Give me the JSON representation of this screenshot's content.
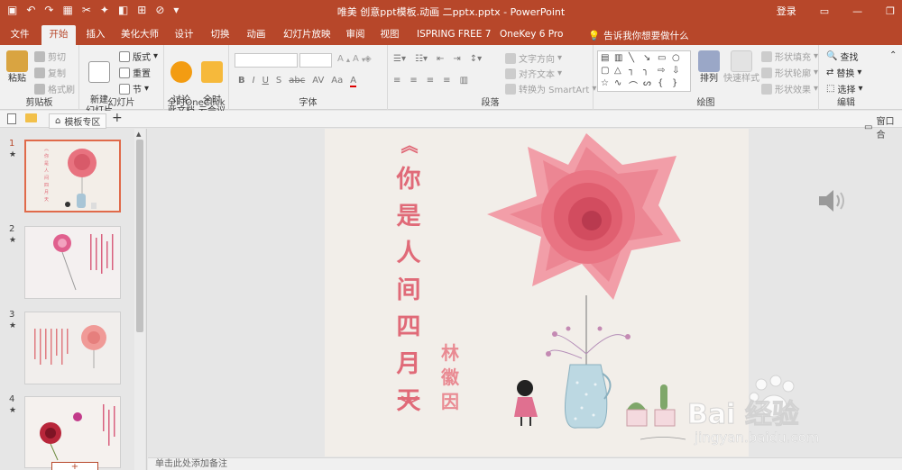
{
  "window": {
    "title": "唯美 创意ppt模板.动画 二pptx.pptx  -  PowerPoint",
    "login": "登录"
  },
  "tabs": [
    "文件",
    "开始",
    "插入",
    "美化大师",
    "设计",
    "切换",
    "动画",
    "幻灯片放映",
    "审阅",
    "视图",
    "ISPRING FREE 7",
    "OneKey 6 Pro"
  ],
  "active_tab": "开始",
  "tell_me": "告诉我你想要做什么",
  "ribbon": {
    "clipboard": {
      "label": "剪贴板",
      "paste": "粘贴",
      "cut": "剪切",
      "copy": "复制",
      "format_painter": "格式刷"
    },
    "slides": {
      "label": "幻灯片",
      "new_slide": "新建\n幻灯片",
      "layout": "版式",
      "reset": "重置",
      "section": "节"
    },
    "oneclick": {
      "label": "全时OneClick",
      "discuss": "讨论\n此文档",
      "meeting": "全时\n云会议"
    },
    "font": {
      "label": "字体",
      "bold": "B",
      "italic": "I",
      "underline": "U",
      "strike": "S",
      "abc": "abc",
      "spacing": "AV",
      "case": "Aa",
      "color": "A"
    },
    "paragraph": {
      "label": "段落",
      "text_direction": "文字方向",
      "align_text": "对齐文本",
      "smartart": "转换为 SmartArt"
    },
    "drawing": {
      "label": "绘图",
      "arrange": "排列",
      "quick_styles": "快速样式",
      "fill": "形状填充",
      "outline": "形状轮廓",
      "effects": "形状效果"
    },
    "editing": {
      "label": "编辑",
      "find": "查找",
      "replace": "替换",
      "select": "选择"
    }
  },
  "subbar": {
    "template_zone": "模板专区",
    "add": "+",
    "window": "窗口合"
  },
  "thumbnails": [
    {
      "num": "1",
      "star": "★"
    },
    {
      "num": "2",
      "star": "★"
    },
    {
      "num": "3",
      "star": "★"
    },
    {
      "num": "4",
      "star": "★"
    }
  ],
  "slide": {
    "title_chars": [
      "你",
      "是",
      "人",
      "间",
      "四",
      "月",
      "天"
    ],
    "chevron_top": "︽",
    "chevron_bottom": "︾",
    "author_chars": [
      "林",
      "徽",
      "因"
    ]
  },
  "notes": "单击此处添加备注",
  "watermark": {
    "main": "Bai  经验",
    "sub": "jingyan.baidu.com"
  },
  "colors": {
    "accent": "#b7472a",
    "title_pink": "#e06a78",
    "slide_bg": "#f3efea"
  }
}
